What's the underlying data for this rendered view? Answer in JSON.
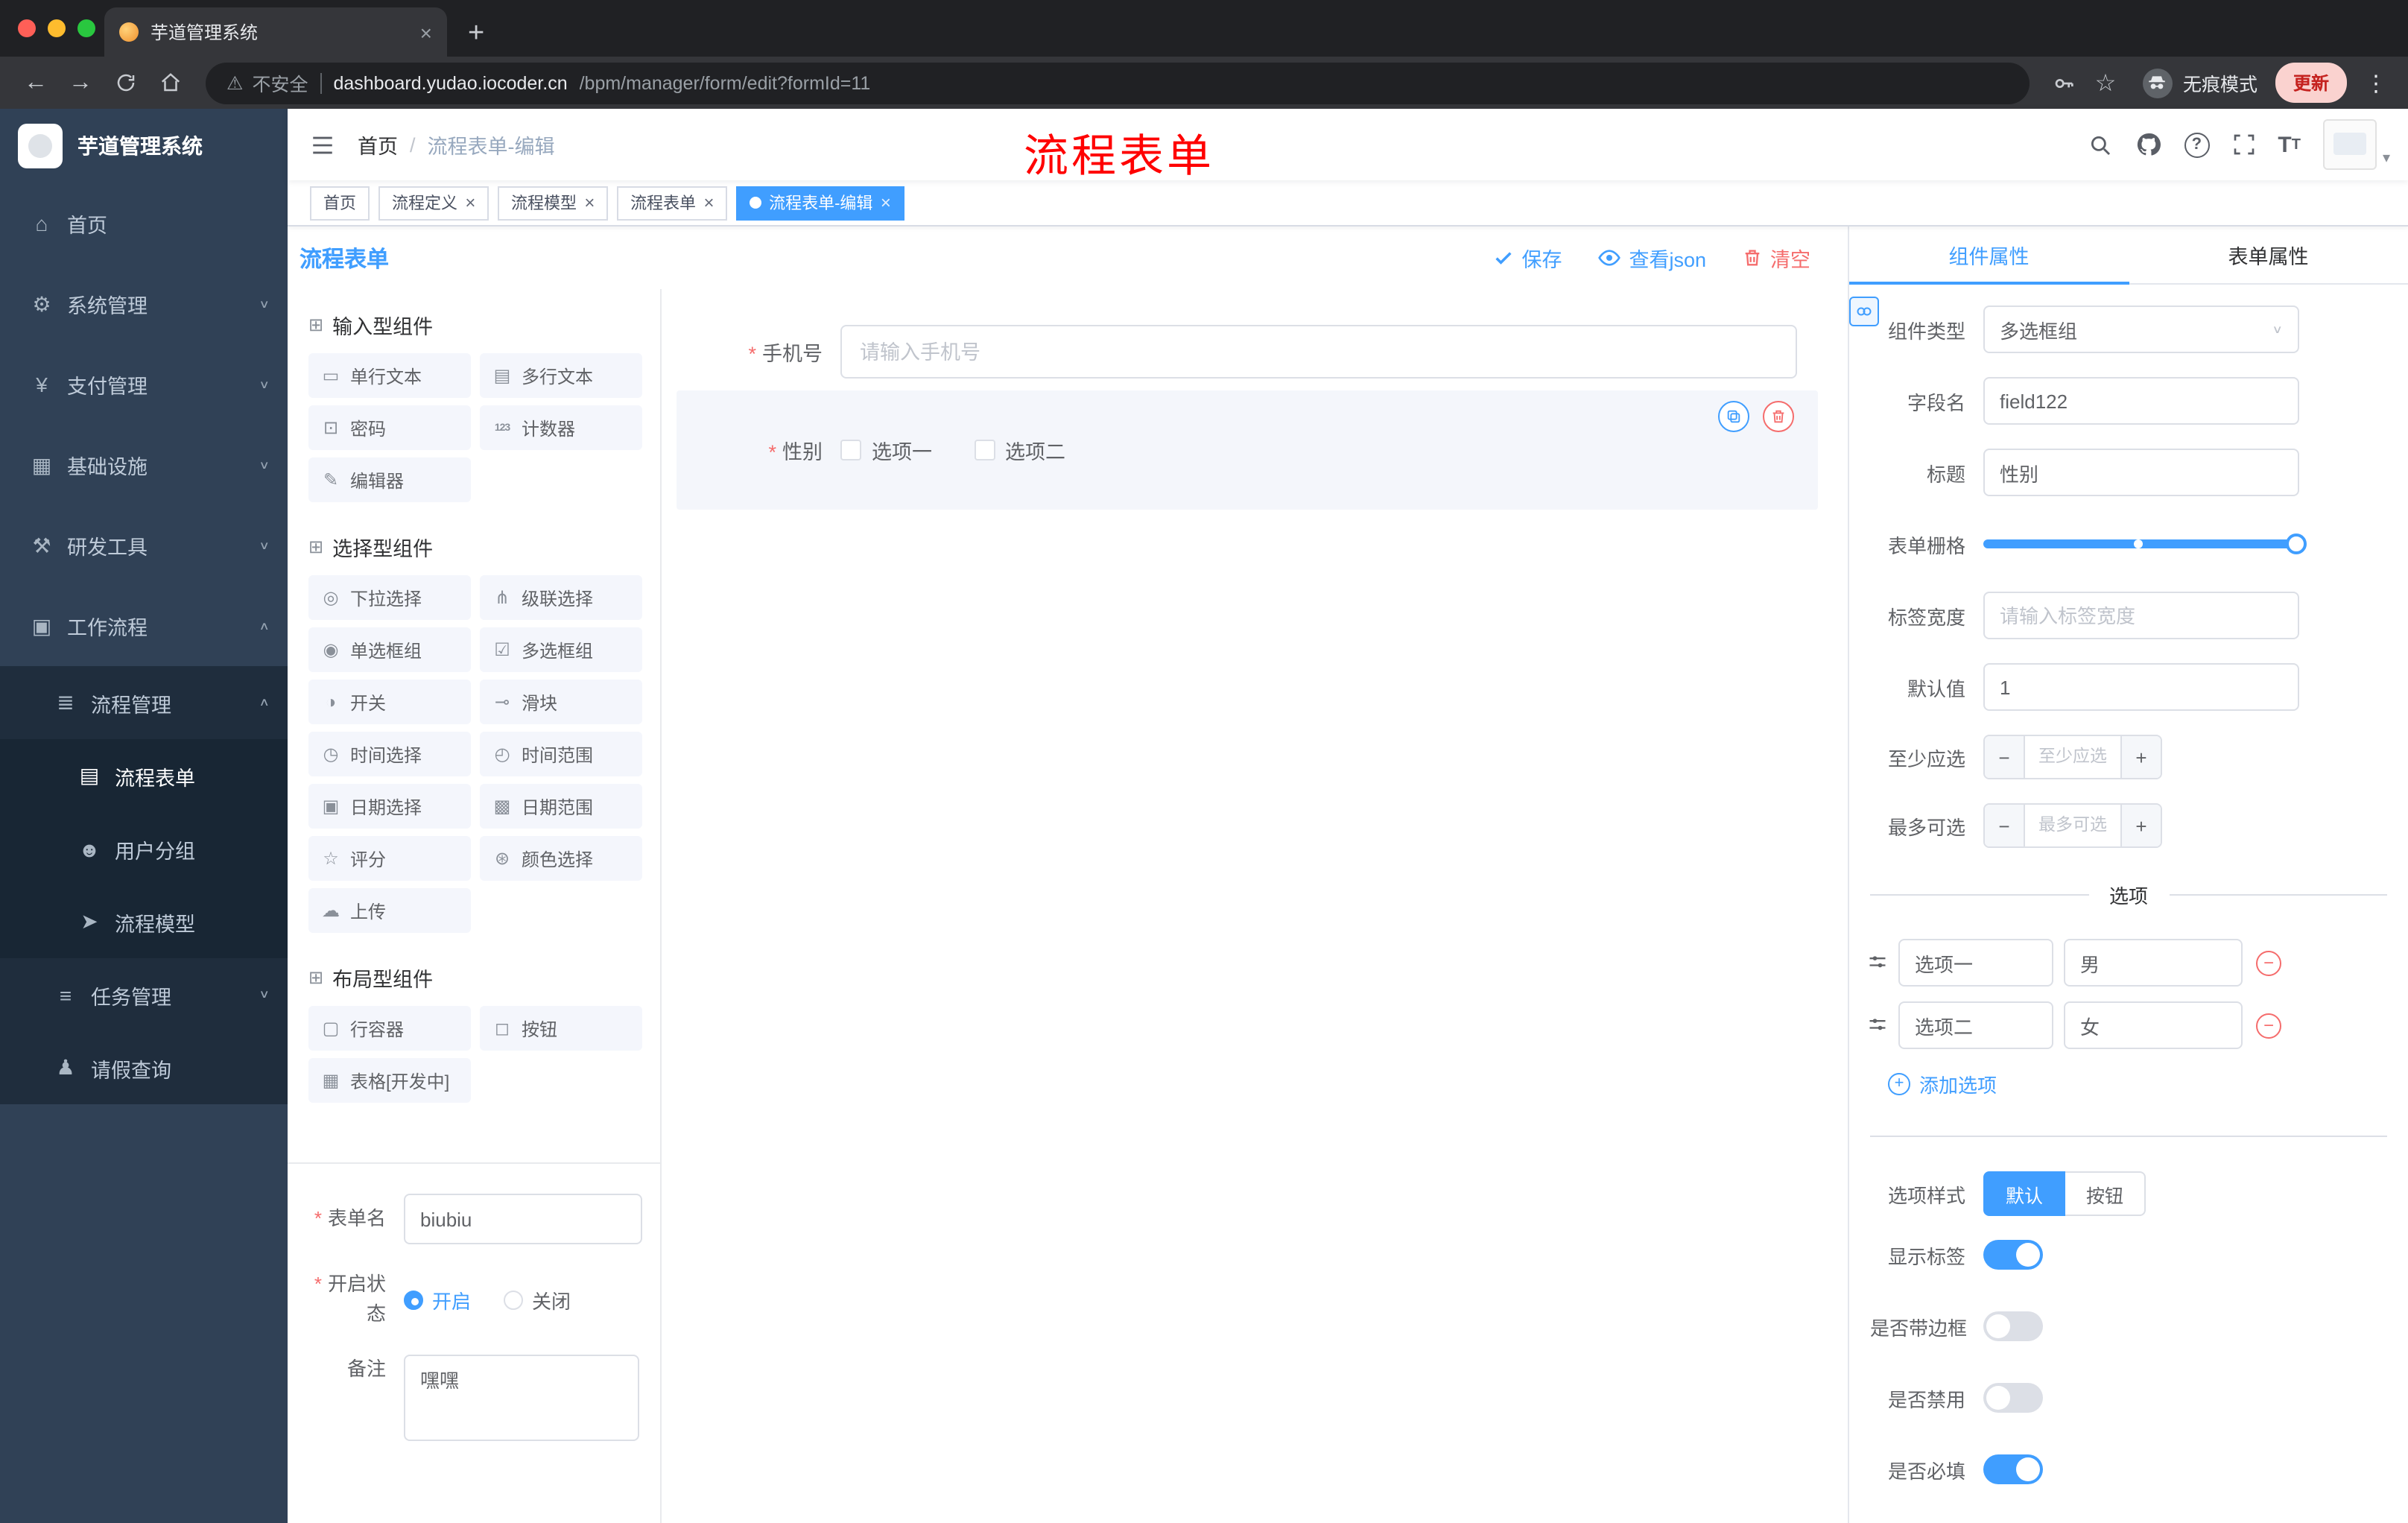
{
  "colors": {
    "accent": "#409eff",
    "danger": "#f56c6c",
    "annotation": "#ff0000",
    "sidebar_bg": "#304156",
    "sidebar_sub_bg": "#1f2d3d"
  },
  "browser": {
    "tab_title": "芋道管理系统",
    "security_label": "不安全",
    "url_host": "dashboard.yudao.iocoder.cn",
    "url_path": "/bpm/manager/form/edit?formId=11",
    "incognito_label": "无痕模式",
    "update_label": "更新"
  },
  "sidebar": {
    "app_title": "芋道管理系统",
    "menu": [
      {
        "label": "首页",
        "slug": "home",
        "glyph": "⌂",
        "level": 1,
        "arrow": "",
        "active": false
      },
      {
        "label": "系统管理",
        "slug": "system-management",
        "glyph": "⚙",
        "level": 1,
        "arrow": "down",
        "active": false
      },
      {
        "label": "支付管理",
        "slug": "payment-management",
        "glyph": "¥",
        "level": 1,
        "arrow": "down",
        "active": false
      },
      {
        "label": "基础设施",
        "slug": "infrastructure",
        "glyph": "▦",
        "level": 1,
        "arrow": "down",
        "active": false
      },
      {
        "label": "研发工具",
        "slug": "dev-tools",
        "glyph": "⚒",
        "level": 1,
        "arrow": "down",
        "active": false
      },
      {
        "label": "工作流程",
        "slug": "workflow",
        "glyph": "▣",
        "level": 1,
        "arrow": "up",
        "active": false
      },
      {
        "label": "流程管理",
        "slug": "process-management",
        "glyph": "≣",
        "level": 2,
        "arrow": "up",
        "active": false
      },
      {
        "label": "流程表单",
        "slug": "process-form",
        "glyph": "▤",
        "level": 3,
        "arrow": "",
        "active": true
      },
      {
        "label": "用户分组",
        "slug": "user-group",
        "glyph": "☻",
        "level": 3,
        "arrow": "",
        "active": false
      },
      {
        "label": "流程模型",
        "slug": "process-model",
        "glyph": "➤",
        "level": 3,
        "arrow": "",
        "active": false
      },
      {
        "label": "任务管理",
        "slug": "task-management",
        "glyph": "≡",
        "level": 2,
        "arrow": "down",
        "active": false
      },
      {
        "label": "请假查询",
        "slug": "leave-query",
        "glyph": "♟",
        "level": 2,
        "arrow": "",
        "active": false
      }
    ]
  },
  "header": {
    "breadcrumb_home": "首页",
    "breadcrumb_separator": "/",
    "breadcrumb_current": "流程表单-编辑",
    "annotation": "流程表单"
  },
  "tags": [
    {
      "label": "首页",
      "slug": "home",
      "closable": false,
      "active": false
    },
    {
      "label": "流程定义",
      "slug": "process-definition",
      "closable": true,
      "active": false
    },
    {
      "label": "流程模型",
      "slug": "process-model",
      "closable": true,
      "active": false
    },
    {
      "label": "流程表单",
      "slug": "process-form",
      "closable": true,
      "active": false
    },
    {
      "label": "流程表单-编辑",
      "slug": "process-form-edit",
      "closable": true,
      "active": true
    }
  ],
  "designer": {
    "title": "流程表单",
    "actions": [
      {
        "label": "保存",
        "slug": "save",
        "icon": "check",
        "color": "#409eff"
      },
      {
        "label": "查看json",
        "slug": "view-json",
        "icon": "eye",
        "color": "#409eff"
      },
      {
        "label": "清空",
        "slug": "clear",
        "icon": "trash",
        "color": "#f56c6c"
      }
    ],
    "palette": {
      "groups": [
        {
          "title": "输入型组件",
          "items": [
            {
              "label": "单行文本",
              "slug": "single-line-text",
              "glyph": "▭"
            },
            {
              "label": "多行文本",
              "slug": "multi-line-text",
              "glyph": "▤"
            },
            {
              "label": "密码",
              "slug": "password",
              "glyph": "⊡"
            },
            {
              "label": "计数器",
              "slug": "counter",
              "glyph": "123"
            },
            {
              "label": "编辑器",
              "slug": "editor",
              "glyph": "✎"
            }
          ]
        },
        {
          "title": "选择型组件",
          "items": [
            {
              "label": "下拉选择",
              "slug": "select",
              "glyph": "◎"
            },
            {
              "label": "级联选择",
              "slug": "cascader",
              "glyph": "⋔"
            },
            {
              "label": "单选框组",
              "slug": "radio-group",
              "glyph": "◉"
            },
            {
              "label": "多选框组",
              "slug": "checkbox-group",
              "glyph": "☑"
            },
            {
              "label": "开关",
              "slug": "switch",
              "glyph": "◑"
            },
            {
              "label": "滑块",
              "slug": "slider",
              "glyph": "⊸"
            },
            {
              "label": "时间选择",
              "slug": "time-picker",
              "glyph": "◷"
            },
            {
              "label": "时间范围",
              "slug": "time-range",
              "glyph": "◴"
            },
            {
              "label": "日期选择",
              "slug": "date-picker",
              "glyph": "▣"
            },
            {
              "label": "日期范围",
              "slug": "date-range",
              "glyph": "▩"
            },
            {
              "label": "评分",
              "slug": "rate",
              "glyph": "☆"
            },
            {
              "label": "颜色选择",
              "slug": "color-picker",
              "glyph": "⊛"
            },
            {
              "label": "上传",
              "slug": "upload",
              "glyph": "☁"
            }
          ]
        },
        {
          "title": "布局型组件",
          "items": [
            {
              "label": "行容器",
              "slug": "row-container",
              "glyph": "▢"
            },
            {
              "label": "按钮",
              "slug": "button",
              "glyph": "◻"
            },
            {
              "label": "表格[开发中]",
              "slug": "table-dev",
              "glyph": "▦"
            }
          ]
        }
      ]
    },
    "meta": {
      "form_name_label": "表单名",
      "form_name_value": "biubiu",
      "status_label": "开启状态",
      "status_on": "开启",
      "status_off": "关闭",
      "remark_label": "备注",
      "remark_value": "嘿嘿"
    },
    "canvas": {
      "phone_label": "手机号",
      "phone_placeholder": "请输入手机号",
      "gender_label": "性别",
      "gender_options": [
        "选项一",
        "选项二"
      ]
    }
  },
  "properties": {
    "tab_component": "组件属性",
    "tab_form": "表单属性",
    "fields": {
      "component_type_label": "组件类型",
      "component_type_value": "多选框组",
      "field_name_label": "字段名",
      "field_name_value": "field122",
      "title_label": "标题",
      "title_value": "性别",
      "grid_label": "表单栅格",
      "label_width_label": "标签宽度",
      "label_width_placeholder": "请输入标签宽度",
      "default_label": "默认值",
      "default_value": "1",
      "min_label": "至少应选",
      "min_placeholder": "至少应选",
      "max_label": "最多可选",
      "max_placeholder": "最多可选"
    },
    "options_divider": "选项",
    "options": [
      {
        "name": "选项一",
        "value": "男"
      },
      {
        "name": "选项二",
        "value": "女"
      }
    ],
    "add_option_label": "添加选项",
    "style_label": "选项样式",
    "style_default": "默认",
    "style_button": "按钮",
    "toggles": [
      {
        "label": "显示标签",
        "slug": "show-label",
        "on": true
      },
      {
        "label": "是否带边框",
        "slug": "bordered",
        "on": false
      },
      {
        "label": "是否禁用",
        "slug": "disabled",
        "on": false
      },
      {
        "label": "是否必填",
        "slug": "required",
        "on": true
      }
    ]
  }
}
